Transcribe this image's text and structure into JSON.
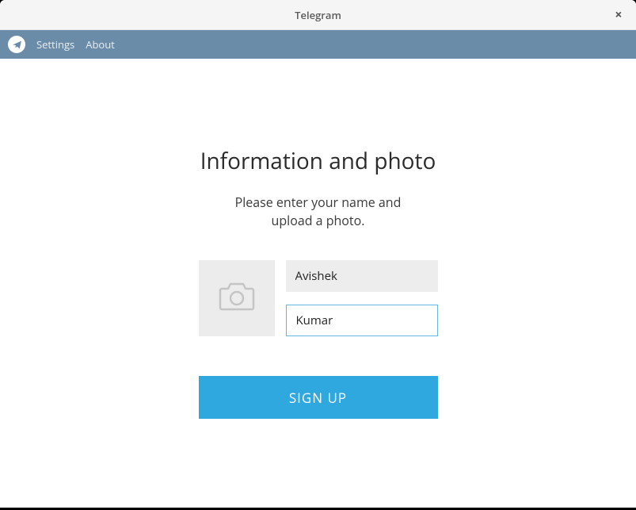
{
  "window": {
    "title": "Telegram",
    "close_symbol": "×"
  },
  "menubar": {
    "settings": "Settings",
    "about": "About"
  },
  "page": {
    "heading": "Information and photo",
    "subtext_line1": "Please enter your name and",
    "subtext_line2": "upload a photo."
  },
  "form": {
    "first_name": "Avishek",
    "last_name": "Kumar",
    "signup_label": "SIGN UP"
  },
  "colors": {
    "menubar_bg": "#6a8ca8",
    "accent": "#2fa8e0",
    "input_focus_border": "#66b7e2"
  }
}
